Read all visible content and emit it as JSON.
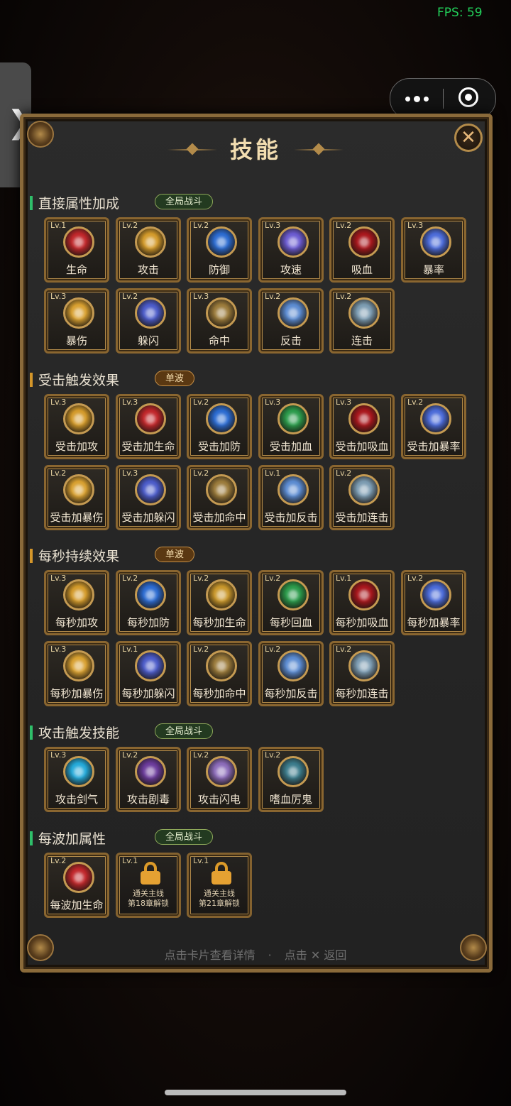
{
  "fps": "FPS: 59",
  "title": "技能",
  "footer": {
    "hint_left": "点击卡片查看详情",
    "dot": "·",
    "hint_right": "点击 ✕ 返回"
  },
  "sections": [
    {
      "title": "直接属性加成",
      "badge": "全局战斗",
      "badge_style": "global",
      "bar_color": "#2fbf6a",
      "cards": [
        {
          "level": "Lv.1",
          "name": "生命",
          "icon": "red-gem-icon",
          "color": "#c0262a"
        },
        {
          "level": "Lv.2",
          "name": "攻击",
          "icon": "gold-claw-icon",
          "color": "#d39a2a"
        },
        {
          "level": "Lv.2",
          "name": "防御",
          "icon": "blue-shield-icon",
          "color": "#2a6ad0"
        },
        {
          "level": "Lv.3",
          "name": "攻速",
          "icon": "purple-swirl-icon",
          "color": "#6a5ad0"
        },
        {
          "level": "Lv.2",
          "name": "吸血",
          "icon": "red-vortex-icon",
          "color": "#a8161c"
        },
        {
          "level": "Lv.3",
          "name": "暴率",
          "icon": "lightning-orb-icon",
          "color": "#4a6ad8"
        },
        {
          "level": "Lv.3",
          "name": "暴伤",
          "icon": "gold-burst-icon",
          "color": "#d8a030"
        },
        {
          "level": "Lv.2",
          "name": "躲闪",
          "icon": "blue-wing-icon",
          "color": "#4a5ac8"
        },
        {
          "level": "Lv.3",
          "name": "命中",
          "icon": "target-icon",
          "color": "#9a7a3a"
        },
        {
          "level": "Lv.2",
          "name": "反击",
          "icon": "sword-shield-icon",
          "color": "#5a8ad0"
        },
        {
          "level": "Lv.2",
          "name": "连击",
          "icon": "triple-slash-icon",
          "color": "#7a9ab0"
        }
      ]
    },
    {
      "title": "受击触发效果",
      "badge": "单波",
      "badge_style": "wave",
      "bar_color": "#d4962a",
      "cards": [
        {
          "level": "Lv.3",
          "name": "受击加攻",
          "icon": "gold-claw-icon",
          "color": "#d39a2a"
        },
        {
          "level": "Lv.3",
          "name": "受击加生命",
          "icon": "red-gem-icon",
          "color": "#c0262a"
        },
        {
          "level": "Lv.2",
          "name": "受击加防",
          "icon": "blue-shield-icon",
          "color": "#2a6ad0"
        },
        {
          "level": "Lv.3",
          "name": "受击加血",
          "icon": "green-leaf-icon",
          "color": "#2a9a4a"
        },
        {
          "level": "Lv.3",
          "name": "受击加吸血",
          "icon": "red-vortex-icon",
          "color": "#a8161c"
        },
        {
          "level": "Lv.2",
          "name": "受击加暴率",
          "icon": "lightning-orb-icon",
          "color": "#4a6ad8"
        },
        {
          "level": "Lv.2",
          "name": "受击加暴伤",
          "icon": "gold-burst-icon",
          "color": "#d8a030"
        },
        {
          "level": "Lv.3",
          "name": "受击加躲闪",
          "icon": "blue-wing-icon",
          "color": "#4a5ac8"
        },
        {
          "level": "Lv.2",
          "name": "受击加命中",
          "icon": "target-icon",
          "color": "#9a7a3a"
        },
        {
          "level": "Lv.1",
          "name": "受击加反击",
          "icon": "sword-shield-icon",
          "color": "#5a8ad0"
        },
        {
          "level": "Lv.2",
          "name": "受击加连击",
          "icon": "triple-slash-icon",
          "color": "#7a9ab0"
        }
      ]
    },
    {
      "title": "每秒持续效果",
      "badge": "单波",
      "badge_style": "wave",
      "bar_color": "#d4962a",
      "cards": [
        {
          "level": "Lv.3",
          "name": "每秒加攻",
          "icon": "gold-claw-icon",
          "color": "#d39a2a"
        },
        {
          "level": "Lv.2",
          "name": "每秒加防",
          "icon": "blue-shield-icon",
          "color": "#2a6ad0"
        },
        {
          "level": "Lv.2",
          "name": "每秒加生命",
          "icon": "gold-swirl-icon",
          "color": "#c8962a"
        },
        {
          "level": "Lv.2",
          "name": "每秒回血",
          "icon": "green-leaf-icon",
          "color": "#2a9a4a"
        },
        {
          "level": "Lv.1",
          "name": "每秒加吸血",
          "icon": "red-vortex-icon",
          "color": "#a8161c"
        },
        {
          "level": "Lv.2",
          "name": "每秒加暴率",
          "icon": "lightning-orb-icon",
          "color": "#4a6ad8"
        },
        {
          "level": "Lv.3",
          "name": "每秒加暴伤",
          "icon": "gold-burst-icon",
          "color": "#d8a030"
        },
        {
          "level": "Lv.1",
          "name": "每秒加躲闪",
          "icon": "blue-wing-icon",
          "color": "#4a5ac8"
        },
        {
          "level": "Lv.2",
          "name": "每秒加命中",
          "icon": "target-icon",
          "color": "#9a7a3a"
        },
        {
          "level": "Lv.2",
          "name": "每秒加反击",
          "icon": "sword-shield-icon",
          "color": "#5a8ad0"
        },
        {
          "level": "Lv.2",
          "name": "每秒加连击",
          "icon": "triple-slash-icon",
          "color": "#7a9ab0"
        }
      ]
    },
    {
      "title": "攻击触发技能",
      "badge": "全局战斗",
      "badge_style": "global",
      "bar_color": "#2fbf6a",
      "cards": [
        {
          "level": "Lv.3",
          "name": "攻击剑气",
          "icon": "cyan-slash-icon",
          "color": "#22a8d8"
        },
        {
          "level": "Lv.2",
          "name": "攻击剧毒",
          "icon": "poison-skull-icon",
          "color": "#6a3a9a"
        },
        {
          "level": "Lv.2",
          "name": "攻击闪电",
          "icon": "lightning-bolt-icon",
          "color": "#8a6ab8"
        },
        {
          "level": "Lv.2",
          "name": "嗜血厉鬼",
          "icon": "ghost-icon",
          "color": "#3a7a8a"
        }
      ]
    },
    {
      "title": "每波加属性",
      "badge": "全局战斗",
      "badge_style": "global",
      "bar_color": "#2fbf6a",
      "cards": [
        {
          "level": "Lv.2",
          "name": "每波加生命",
          "icon": "red-gem-icon",
          "color": "#c0262a"
        },
        {
          "level": "Lv.1",
          "locked": true,
          "unlock_line1": "通关主线",
          "unlock_line2": "第18章解锁",
          "icon": "lock-icon",
          "color": "#f0a833"
        },
        {
          "level": "Lv.1",
          "locked": true,
          "unlock_line1": "通关主线",
          "unlock_line2": "第21章解锁",
          "icon": "lock-icon",
          "color": "#f0a833"
        }
      ]
    }
  ]
}
